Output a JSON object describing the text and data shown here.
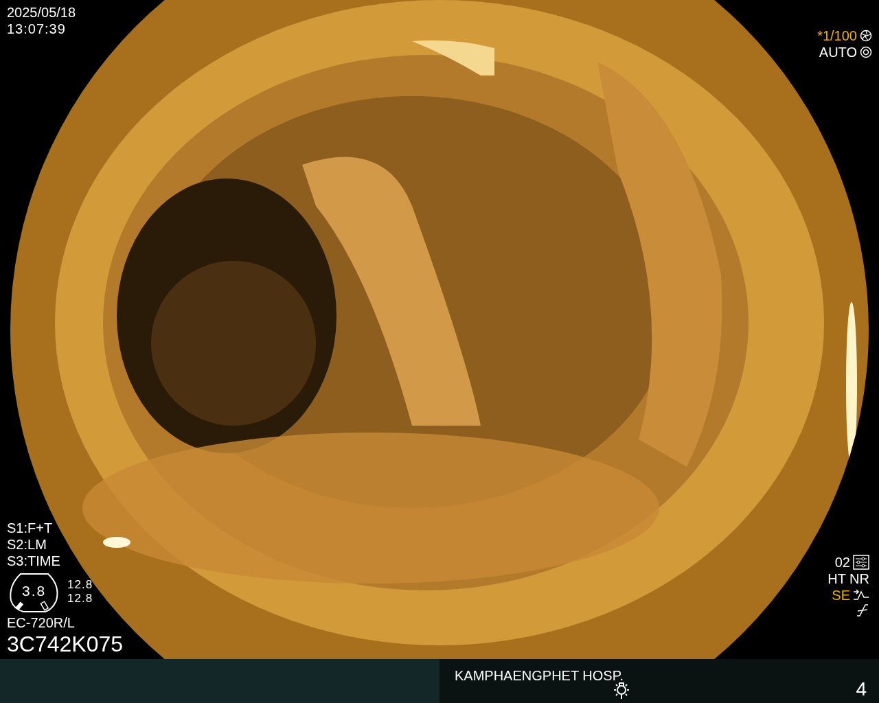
{
  "timestamp": {
    "date": "2025/05/18",
    "time": "13:07:39"
  },
  "exposure": {
    "shutter": "*1/100",
    "shutter_highlighted": true,
    "mode": "AUTO"
  },
  "settings": [
    "S1:F+T",
    "S2:LM",
    "S3:TIME"
  ],
  "scope_gauge": {
    "center": "3.8",
    "readings": [
      "12.8",
      "12.8"
    ]
  },
  "scope_model": "EC-720R/L",
  "serial": "3C742K075",
  "processing": [
    {
      "text": "02",
      "kind": "preset",
      "highlighted": false
    },
    {
      "text": "HT NR",
      "kind": "plain",
      "highlighted": false
    },
    {
      "text": "SE",
      "kind": "enhance",
      "highlighted": true
    },
    {
      "kind": "curve"
    }
  ],
  "footer": {
    "institution": "KAMPHAENGPHET HOSP.",
    "page": "4"
  }
}
